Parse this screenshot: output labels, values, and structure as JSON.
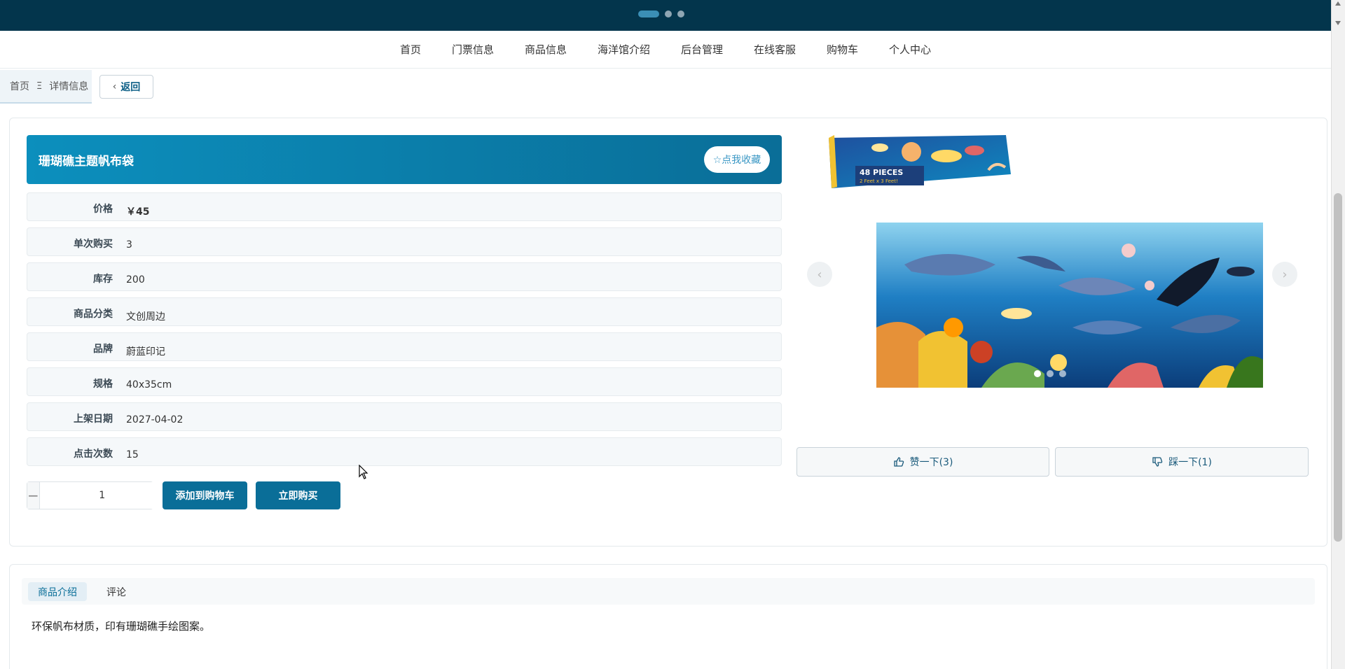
{
  "nav": {
    "items": [
      "首页",
      "门票信息",
      "商品信息",
      "海洋馆介绍",
      "后台管理",
      "在线客服",
      "购物车",
      "个人中心"
    ]
  },
  "breadcrumb": {
    "home": "首页",
    "separator": "Ξ",
    "current": "详情信息"
  },
  "back_button": {
    "label": "返回"
  },
  "product": {
    "title": "珊瑚礁主题帆布袋",
    "favorite_label": "☆点我收藏",
    "fields": [
      {
        "label": "价格",
        "value": "￥45"
      },
      {
        "label": "单次购买",
        "value": "3"
      },
      {
        "label": "库存",
        "value": "200"
      },
      {
        "label": "商品分类",
        "value": "文创周边"
      },
      {
        "label": "品牌",
        "value": "蔚蓝印记"
      },
      {
        "label": "规格",
        "value": "40x35cm"
      },
      {
        "label": "上架日期",
        "value": "2027-04-02"
      },
      {
        "label": "点击次数",
        "value": "15"
      }
    ]
  },
  "quantity": {
    "minus": "−",
    "value": "1",
    "plus": "+"
  },
  "actions": {
    "add_to_cart": "添加到购物车",
    "buy_now": "立即购买"
  },
  "gallery": {
    "thumb_caption": "48 PIECES",
    "thumb_subcaption": "2 Feet x 3 Feet!",
    "slide_count": 3,
    "active_slide": 1
  },
  "votes": {
    "like": "赞一下(3)",
    "dislike": "踩一下(1)"
  },
  "tabs": {
    "intro": "商品介绍",
    "comments": "评论"
  },
  "description": "环保帆布材质，印有珊瑚礁手绘图案。",
  "colors": {
    "header": "#03354c",
    "primary": "#0a6e98",
    "title_gradient_start": "#0c8fbd"
  }
}
